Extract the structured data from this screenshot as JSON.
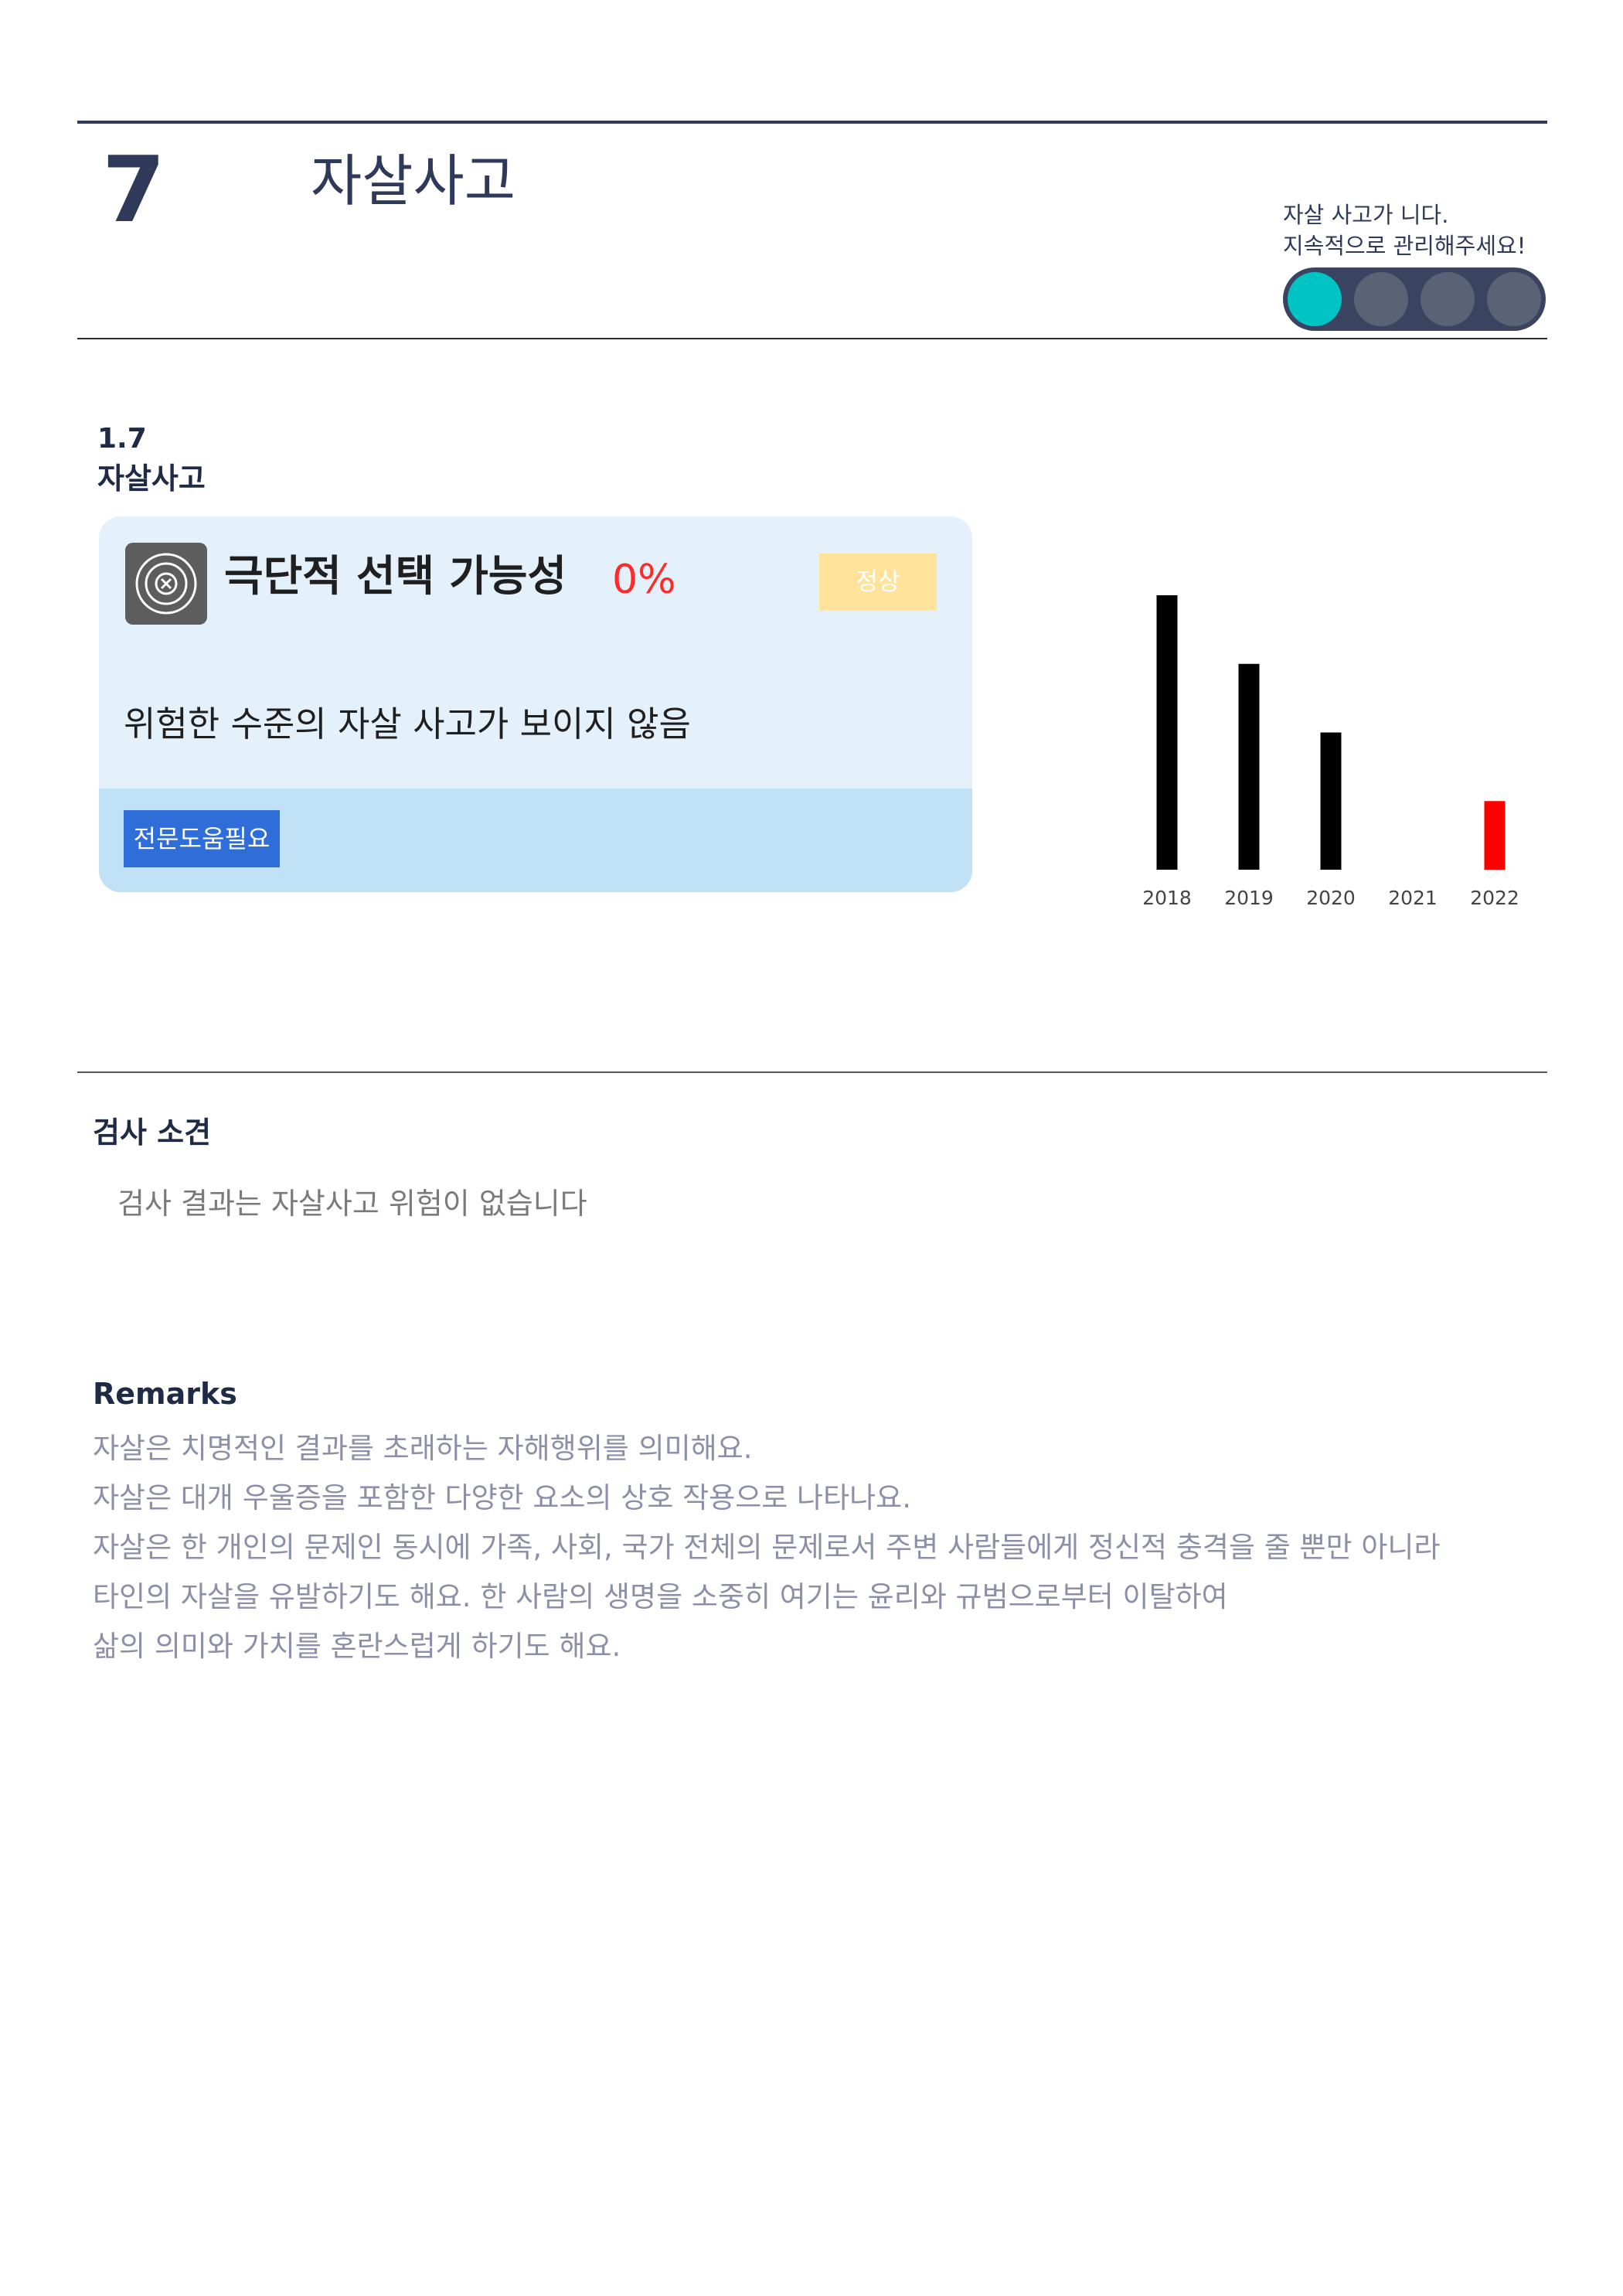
{
  "header": {
    "chapter_number": "7",
    "chapter_title": "자살사고",
    "status_message_line1": "자살 사고가 니다.",
    "status_message_line2": "지속적으로 관리해주세요!",
    "level_active_color": "#00c4c4",
    "level_inactive_color": "#5a6275",
    "level_active_index": 0,
    "level_count": 4
  },
  "section": {
    "number": "1.7",
    "name": "자살사고"
  },
  "card": {
    "icon": "target-icon",
    "title": "극단적 선택 가능성",
    "percent": "0%",
    "badge": "정상",
    "description": "위험한 수준의 자살 사고가 보이지 않음",
    "help_button": "전문도움필요"
  },
  "chart_data": {
    "type": "bar",
    "categories": [
      "2018",
      "2019",
      "2020",
      "2021",
      "2022"
    ],
    "values": [
      100,
      75,
      50,
      0,
      25
    ],
    "colors": [
      "#000000",
      "#000000",
      "#000000",
      "#000000",
      "#ff0000"
    ],
    "ylim": [
      0,
      100
    ],
    "grid": false
  },
  "findings": {
    "title": "검사 소견",
    "text": "검사 결과는 자살사고 위험이 없습니다"
  },
  "remarks": {
    "title": "Remarks",
    "lines": [
      "자살은 치명적인 결과를 초래하는 자해행위를 의미해요.",
      "자살은 대개 우울증을 포함한 다양한 요소의 상호 작용으로 나타나요.",
      "자살은 한 개인의 문제인 동시에 가족, 사회, 국가 전체의 문제로서 주변 사람들에게 정신적 충격을 줄 뿐만 아니라",
      "타인의 자살을 유발하기도 해요. 한 사람의 생명을 소중히 여기는 윤리와 규범으로부터 이탈하여",
      "삶의 의미와 가치를 혼란스럽게 하기도 해요."
    ]
  }
}
